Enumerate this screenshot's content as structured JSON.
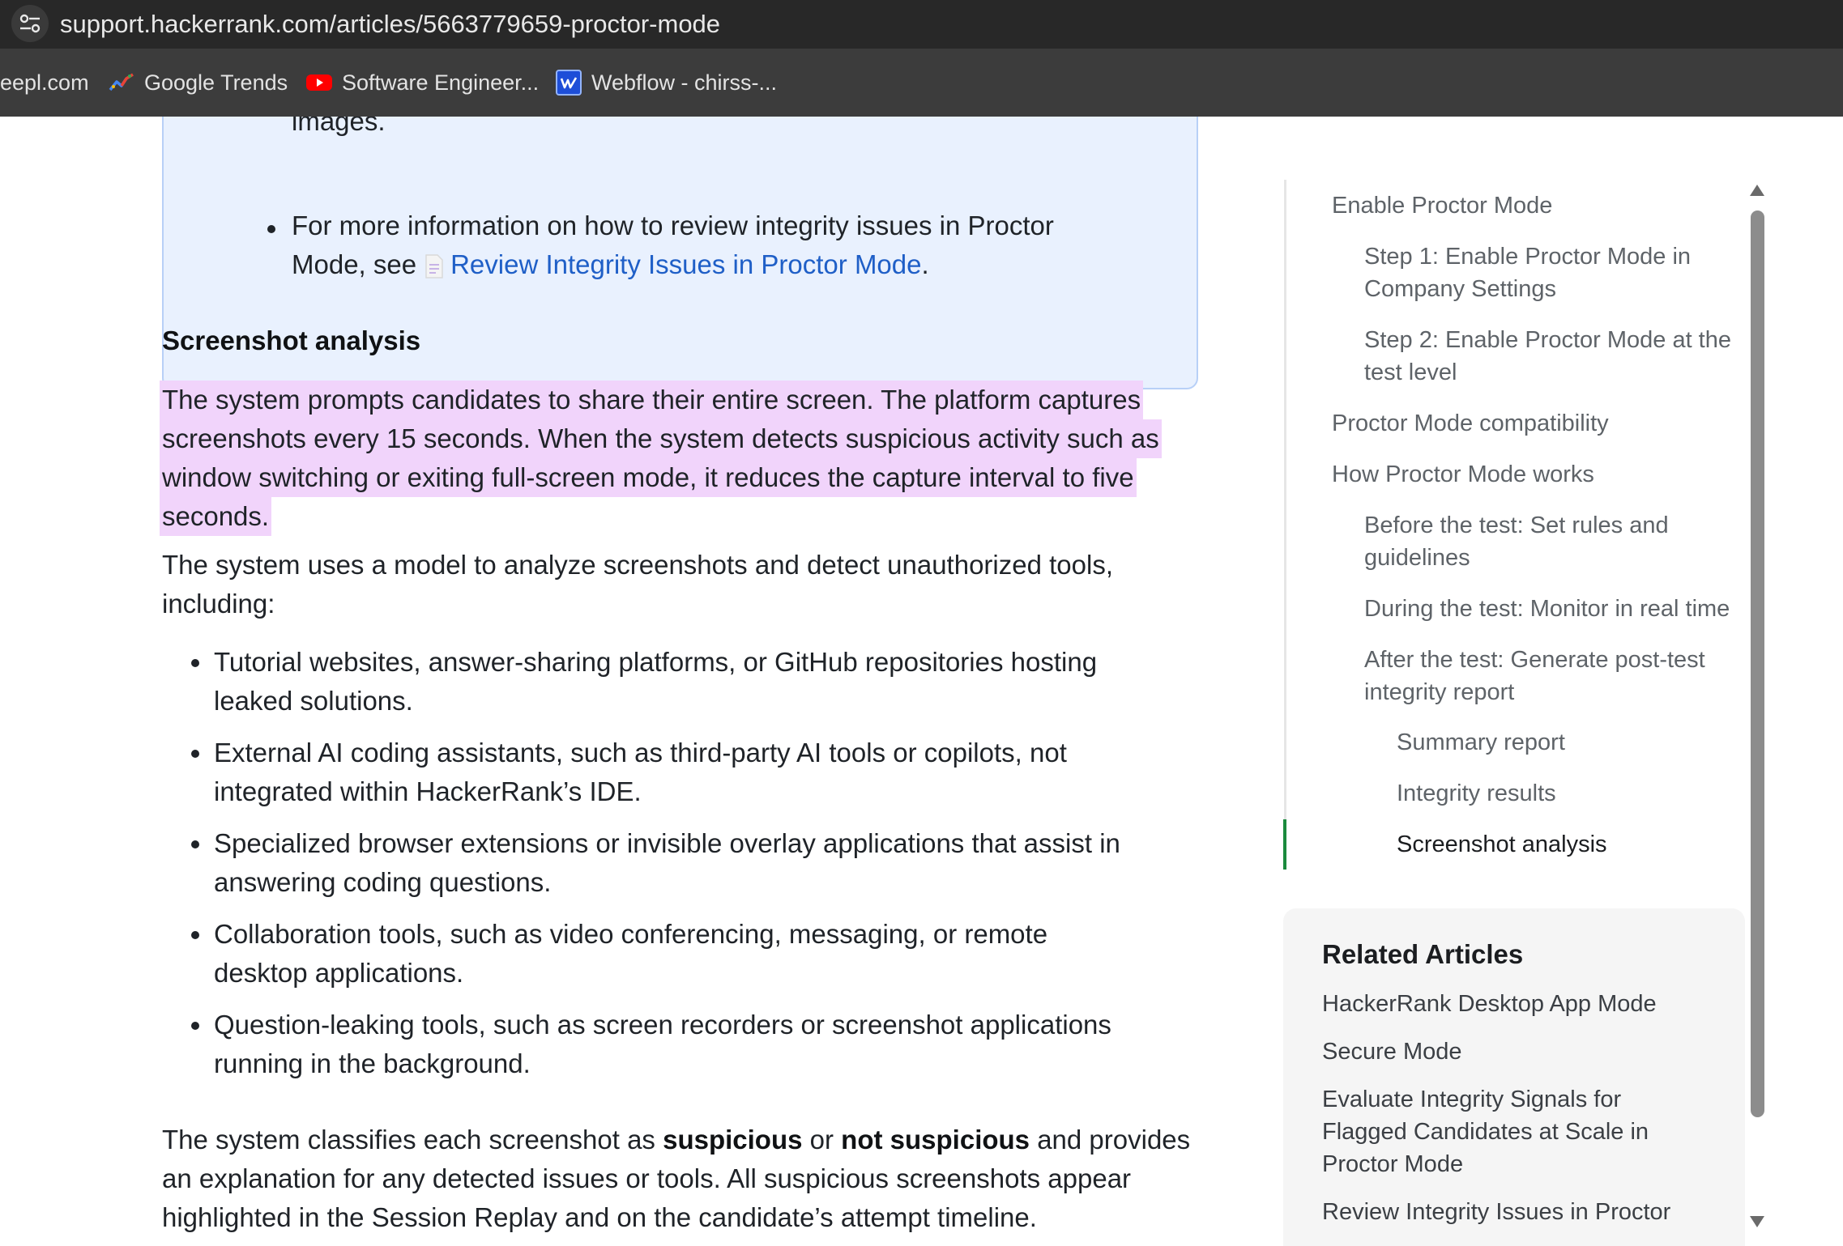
{
  "browser": {
    "url": "support.hackerrank.com/articles/5663779659-proctor-mode",
    "bookmarks": [
      {
        "label": "eepl.com"
      },
      {
        "label": "Google Trends"
      },
      {
        "label": "Software Engineer..."
      },
      {
        "label": "Webflow - chirss-..."
      }
    ]
  },
  "callout": {
    "line_prev": "images.",
    "bullet_line1": "For more information on how to review integrity issues in Proctor",
    "bullet_line2_prefix": "Mode, see",
    "bullet_link": "Review Integrity Issues in Proctor Mode",
    "bullet_line2_suffix": "."
  },
  "article": {
    "heading": "Screenshot analysis",
    "highlight_lines": [
      "The system prompts candidates to share their entire screen. The platform captures",
      "screenshots every 15 seconds. When the system detects suspicious activity such as",
      "window switching or exiting full-screen mode, it reduces the capture interval to five",
      "seconds."
    ],
    "model_para": [
      "The system uses a model to analyze screenshots and detect unauthorized tools,",
      "including:"
    ],
    "tools": [
      [
        "Tutorial websites, answer-sharing platforms, or GitHub repositories hosting",
        "leaked solutions."
      ],
      [
        "External AI coding assistants, such as third-party AI tools or copilots, not",
        "integrated within HackerRank’s IDE."
      ],
      [
        "Specialized browser extensions or invisible overlay applications that assist in",
        "answering coding questions."
      ],
      [
        "Collaboration tools, such as video conferencing, messaging, or remote",
        "desktop applications."
      ],
      [
        "Question-leaking tools, such as screen recorders or screenshot applications",
        "running in the background."
      ]
    ],
    "classify": {
      "p1": "The system classifies each screenshot as",
      "b1": "suspicious",
      "p2": "or",
      "b2": "not suspicious",
      "p3": "and provides",
      "line2": "an explanation for any detected issues or tools. All suspicious screenshots appear",
      "line3": "highlighted in the Session Replay and on the candidate’s attempt timeline."
    }
  },
  "toc": {
    "items": [
      {
        "label": "Enable Proctor Mode"
      },
      {
        "label": "Step 1: Enable Proctor Mode in",
        "label2": "Company Settings"
      },
      {
        "label": "Step 2: Enable Proctor Mode at the",
        "label2": "test level"
      },
      {
        "label": "Proctor Mode compatibility"
      },
      {
        "label": "How Proctor Mode works"
      },
      {
        "label": "Before the test: Set rules and",
        "label2": "guidelines"
      },
      {
        "label": "During the test: Monitor in real time"
      },
      {
        "label": "After the test: Generate post-test",
        "label2": "integrity report"
      },
      {
        "label": "Summary report"
      },
      {
        "label": "Integrity results"
      },
      {
        "label": "Screenshot analysis"
      }
    ]
  },
  "related": {
    "title": "Related Articles",
    "items": [
      {
        "label": "HackerRank Desktop App Mode"
      },
      {
        "label": "Secure Mode"
      },
      {
        "label": "Evaluate Integrity Signals for",
        "label2": "Flagged Candidates at Scale in",
        "label3": "Proctor Mode"
      },
      {
        "label": "Review Integrity Issues in Proctor"
      }
    ]
  }
}
